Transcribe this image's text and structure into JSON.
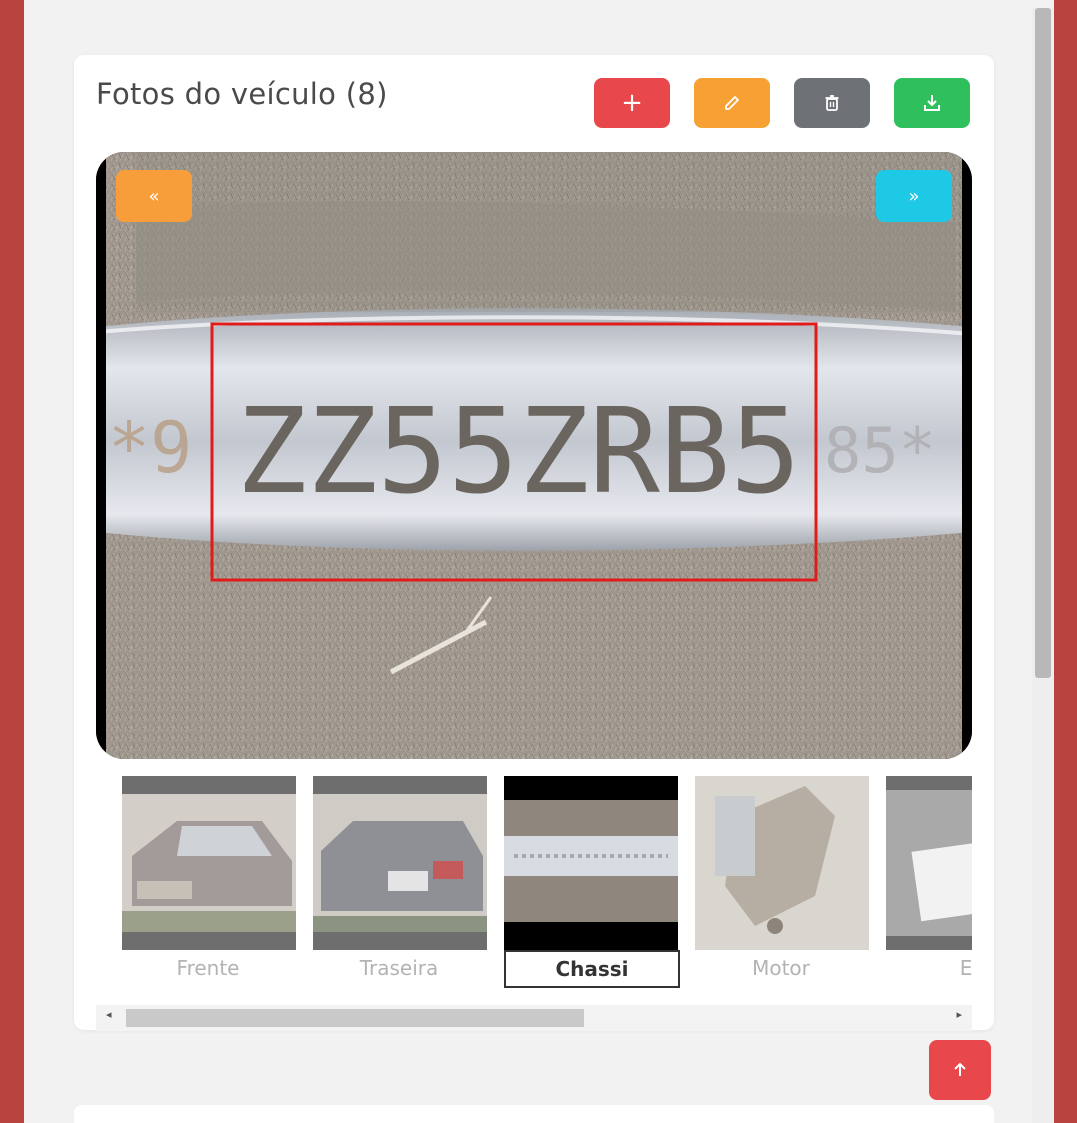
{
  "gallery": {
    "title": "Fotos do veículo (8)",
    "photo_count": 8,
    "toolbar": {
      "add_label": "+",
      "edit_icon": "pencil-icon",
      "delete_icon": "trash-icon",
      "download_icon": "download-icon"
    },
    "viewer": {
      "prev_label": "«",
      "next_label": "»",
      "plate_text": "ZZ55ZRB5",
      "plate_prefix": "*9",
      "plate_suffix": "85*"
    },
    "thumbnails": [
      {
        "label": "Frente",
        "active": false
      },
      {
        "label": "Traseira",
        "active": false
      },
      {
        "label": "Chassi",
        "active": true
      },
      {
        "label": "Motor",
        "active": false
      },
      {
        "label": "Ex",
        "active": false
      }
    ]
  },
  "colors": {
    "accent_red": "#e8474b",
    "accent_orange": "#f7a033",
    "accent_gray": "#6e7276",
    "accent_green": "#2fbf5c",
    "accent_cyan": "#1ec9e6"
  }
}
